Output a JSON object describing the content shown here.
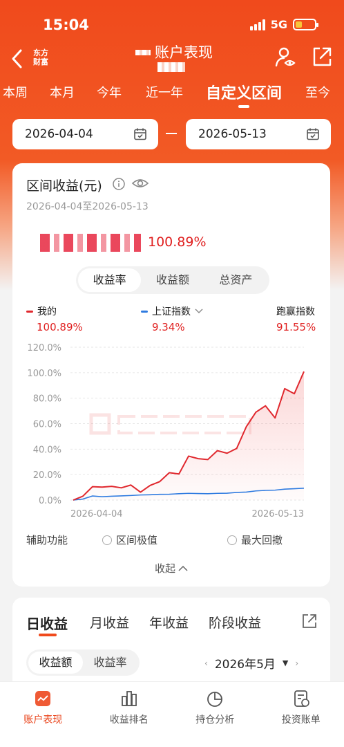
{
  "status": {
    "time": "15:04",
    "network": "5G",
    "battery_level": 0.25
  },
  "nav": {
    "logo_line1": "东方",
    "logo_line2": "财富",
    "title": "账户表现",
    "icons": [
      "back-arrow-icon",
      "person-eye-icon",
      "share-out-icon"
    ]
  },
  "tabs": [
    {
      "label": "本周"
    },
    {
      "label": "本月"
    },
    {
      "label": "今年"
    },
    {
      "label": "近一年"
    },
    {
      "label": "自定义区间",
      "active": true
    },
    {
      "label": "至今"
    }
  ],
  "date_range": {
    "start": "2026-04-04",
    "end": "2026-05-13"
  },
  "summary": {
    "title": "区间收益(元)",
    "range_text": "2026-04-04至2026-05-13",
    "return_pct": "100.89%",
    "segments": [
      "收益率",
      "收益额",
      "总资产"
    ],
    "active_segment": 0
  },
  "legend": {
    "mine": {
      "name": "我的",
      "value": "100.89%",
      "color": "#e0282e"
    },
    "index": {
      "name": "上证指数",
      "value": "9.34%",
      "color": "#2f7be0"
    },
    "beat": {
      "name": "跑赢指数",
      "value": "91.55%"
    }
  },
  "chart_data": {
    "type": "line",
    "x_start_label": "2026-04-04",
    "x_end_label": "2026-05-13",
    "y_ticks": [
      "120.0%",
      "100.0%",
      "80.0%",
      "60.0%",
      "40.0%",
      "20.0%",
      "0.0%"
    ],
    "ylim": [
      0,
      120
    ],
    "series": [
      {
        "name": "我的",
        "color": "#e0282e",
        "values": [
          0,
          3,
          10.5,
          10.2,
          10.8,
          9.6,
          11.8,
          6.2,
          11.5,
          14.5,
          21.5,
          20.5,
          34.5,
          32.5,
          31.8,
          38.8,
          36.8,
          40.5,
          57.5,
          69,
          74,
          64.5,
          87.5,
          83.5,
          100.89
        ]
      },
      {
        "name": "上证指数",
        "color": "#2f7be0",
        "values": [
          0,
          0.8,
          3.2,
          2.6,
          3.0,
          3.3,
          3.6,
          4.0,
          4.2,
          4.5,
          4.6,
          5.0,
          5.3,
          5.1,
          5.0,
          5.3,
          5.4,
          6.0,
          6.3,
          7.2,
          7.6,
          7.8,
          8.6,
          8.9,
          9.34
        ]
      }
    ]
  },
  "assist": {
    "label": "辅助功能",
    "option1": "区间极值",
    "option2": "最大回撤",
    "collapse": "收起"
  },
  "daily": {
    "tabs": [
      "日收益",
      "月收益",
      "年收益",
      "阶段收益"
    ],
    "segments": [
      "收益额",
      "收益率"
    ],
    "month": "2026年5月"
  },
  "bottom_nav": [
    "账户表现",
    "收益排名",
    "持仓分析",
    "投资账单"
  ],
  "colors": {
    "brand": "#f04a1c",
    "up": "#e02020",
    "index_blue": "#2f7be0"
  }
}
